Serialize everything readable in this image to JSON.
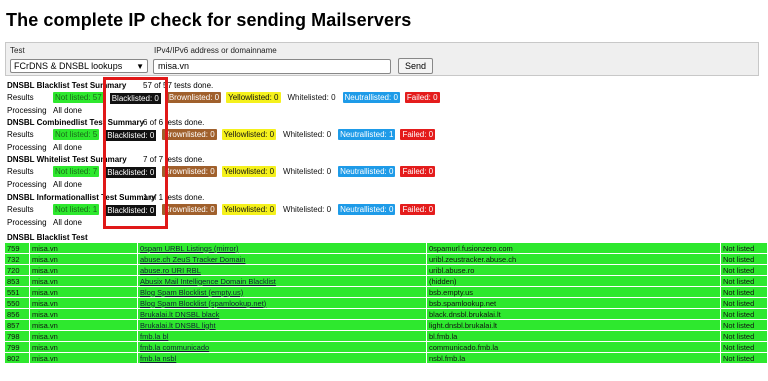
{
  "page": {
    "title": "The complete IP check for sending Mailservers"
  },
  "form": {
    "test_label": "Test",
    "test_value": "FCrDNS & DNSBL lookups",
    "address_label": "IPv4/IPv6 address or domainname",
    "address_value": "misa.vn",
    "send_label": "Send"
  },
  "summaries": [
    {
      "title": "DNSBL Blacklist Test Summary",
      "done": "57 of 57 tests done.",
      "results_label": "Results",
      "badges": [
        "Not listed: 57",
        "Blacklisted: 0",
        "Brownlisted: 0",
        "Yellowlisted: 0",
        "Whitelisted: 0",
        "Neutrallisted: 0",
        "Failed: 0"
      ],
      "processing_label": "Processing",
      "processing_value": "All done"
    },
    {
      "title": "DNSBL Combinedlist Test Summary",
      "done": "6 of 6 tests done.",
      "results_label": "Results",
      "badges": [
        "Not listed: 5",
        "Blacklisted: 0",
        "Brownlisted: 0",
        "Yellowlisted: 0",
        "Whitelisted: 0",
        "Neutrallisted: 1",
        "Failed: 0"
      ],
      "processing_label": "Processing",
      "processing_value": "All done"
    },
    {
      "title": "DNSBL Whitelist Test Summary",
      "done": "7 of 7 tests done.",
      "results_label": "Results",
      "badges": [
        "Not listed: 7",
        "Blacklisted: 0",
        "Brownlisted: 0",
        "Yellowlisted: 0",
        "Whitelisted: 0",
        "Neutrallisted: 0",
        "Failed: 0"
      ],
      "processing_label": "Processing",
      "processing_value": "All done"
    },
    {
      "title": "DNSBL Informationallist Test Summary",
      "done": "1 of 1 tests done.",
      "results_label": "Results",
      "badges": [
        "Not listed: 1",
        "Blacklisted: 0",
        "Brownlisted: 0",
        "Yellowlisted: 0",
        "Whitelisted: 0",
        "Neutrallisted: 0",
        "Failed: 0"
      ],
      "processing_label": "Processing",
      "processing_value": "All done"
    }
  ],
  "results_section": {
    "title": "DNSBL Blacklist Test",
    "rows": [
      [
        "759",
        "misa.vn",
        "0spam URBL Listings (mirror)",
        "0spamurl.fusionzero.com",
        "Not listed"
      ],
      [
        "732",
        "misa.vn",
        "abuse.ch ZeuS Tracker Domain",
        "uribl.zeustracker.abuse.ch",
        "Not listed"
      ],
      [
        "720",
        "misa.vn",
        "abuse.ro URI RBL",
        "uribl.abuse.ro",
        "Not listed"
      ],
      [
        "853",
        "misa.vn",
        "Abusix Mail Intelligence Domain Blacklist",
        "(hidden)",
        "Not listed"
      ],
      [
        "551",
        "misa.vn",
        "Blog Spam Blocklist (empty.us)",
        "bsb.empty.us",
        "Not listed"
      ],
      [
        "550",
        "misa.vn",
        "Blog Spam Blocklist (spamlookup.net)",
        "bsb.spamlookup.net",
        "Not listed"
      ],
      [
        "856",
        "misa.vn",
        "Brukalai.lt DNSBL black",
        "black.dnsbl.brukalai.lt",
        "Not listed"
      ],
      [
        "857",
        "misa.vn",
        "Brukalai.lt DNSBL light",
        "light.dnsbl.brukalai.lt",
        "Not listed"
      ],
      [
        "798",
        "misa.vn",
        "fmb.la bl",
        "bl.fmb.la",
        "Not listed"
      ],
      [
        "799",
        "misa.vn",
        "fmb.la communicado",
        "communicado.fmb.la",
        "Not listed"
      ],
      [
        "802",
        "misa.vn",
        "fmb.la nsbl",
        "nsbl.fmb.la",
        "Not listed"
      ]
    ]
  },
  "colors": {
    "not_listed": "#2ee82e",
    "blacklisted": "#111111",
    "brownlisted": "#a0602c",
    "yellowlisted": "#f5f11c",
    "neutrallisted": "#1e9be8",
    "failed": "#e41c1c",
    "highlight_box": "#e01818"
  }
}
